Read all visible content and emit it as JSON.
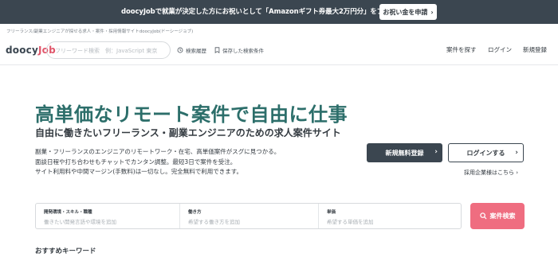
{
  "banner": {
    "text": "doocyJobで就業が決定した方にお祝いとして「Amazonギフト券最大2万円分」をプレゼント🔥",
    "button_label": "お祝い金を申請"
  },
  "breadcrumb": "フリーランス/副業エンジニアが探せる求人・案件・採用情報サイトdoocyJob(ドーシージョブ)",
  "header": {
    "logo_main": "doocy",
    "logo_accent": "Job",
    "search_placeholder": "フリーワード検索　例：JavaScript 東京",
    "history_label": "検索履歴",
    "saved_label": "保存した検索条件",
    "nav": [
      "案件を探す",
      "ログイン",
      "新規登録"
    ]
  },
  "hero": {
    "title": "高単価なリモート案件で自由に仕事",
    "subtitle": "自由に働きたいフリーランス・副業エンジニアのための求人案件サイト",
    "description": [
      "副業・フリーランスのエンジニアのリモートワーク・在宅、高単価案件がスグに見つかる。",
      "面談日程や打ち合わせもチャットでカンタン調整。最短3日で案件を受注。",
      "サイト利用料や中間マージン(手数料)は一切なし。完全無料で利用できます。"
    ],
    "register_button": "新規無料登録",
    "login_button": "ログインする",
    "corporate_link": "採用企業様はこちら"
  },
  "search_panel": {
    "fields": [
      {
        "label": "開発環境・スキル・職種",
        "placeholder": "働きたい開発言語や環境を追加"
      },
      {
        "label": "働き方",
        "placeholder": "希望する働き方を追加"
      },
      {
        "label": "単価",
        "placeholder": "希望する単価を追加"
      }
    ],
    "button": "案件検索"
  },
  "keywords_title": "おすすめキーワード",
  "colors": {
    "dark": "#3b4650",
    "accent": "#2c6e6a",
    "pink": "#ef6d80"
  }
}
